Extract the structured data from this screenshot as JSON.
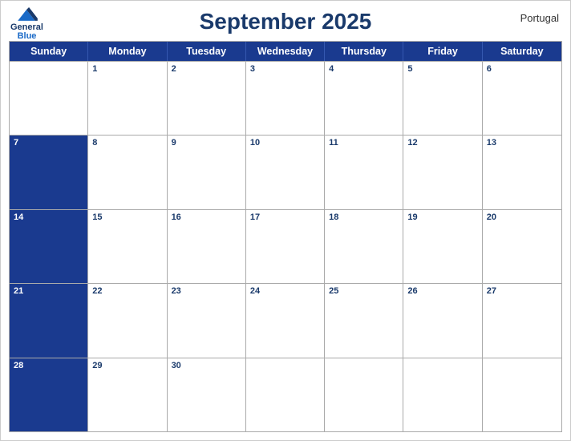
{
  "header": {
    "title": "September 2025",
    "country": "Portugal",
    "logo": {
      "line1": "General",
      "line2": "Blue"
    }
  },
  "days_of_week": [
    "Sunday",
    "Monday",
    "Tuesday",
    "Wednesday",
    "Thursday",
    "Friday",
    "Saturday"
  ],
  "weeks": [
    [
      {
        "num": "",
        "blue": false
      },
      {
        "num": "1",
        "blue": false
      },
      {
        "num": "2",
        "blue": false
      },
      {
        "num": "3",
        "blue": false
      },
      {
        "num": "4",
        "blue": false
      },
      {
        "num": "5",
        "blue": false
      },
      {
        "num": "6",
        "blue": false
      }
    ],
    [
      {
        "num": "7",
        "blue": true
      },
      {
        "num": "8",
        "blue": false
      },
      {
        "num": "9",
        "blue": false
      },
      {
        "num": "10",
        "blue": false
      },
      {
        "num": "11",
        "blue": false
      },
      {
        "num": "12",
        "blue": false
      },
      {
        "num": "13",
        "blue": false
      }
    ],
    [
      {
        "num": "14",
        "blue": true
      },
      {
        "num": "15",
        "blue": false
      },
      {
        "num": "16",
        "blue": false
      },
      {
        "num": "17",
        "blue": false
      },
      {
        "num": "18",
        "blue": false
      },
      {
        "num": "19",
        "blue": false
      },
      {
        "num": "20",
        "blue": false
      }
    ],
    [
      {
        "num": "21",
        "blue": true
      },
      {
        "num": "22",
        "blue": false
      },
      {
        "num": "23",
        "blue": false
      },
      {
        "num": "24",
        "blue": false
      },
      {
        "num": "25",
        "blue": false
      },
      {
        "num": "26",
        "blue": false
      },
      {
        "num": "27",
        "blue": false
      }
    ],
    [
      {
        "num": "28",
        "blue": true
      },
      {
        "num": "29",
        "blue": false
      },
      {
        "num": "30",
        "blue": false
      },
      {
        "num": "",
        "blue": false
      },
      {
        "num": "",
        "blue": false
      },
      {
        "num": "",
        "blue": false
      },
      {
        "num": "",
        "blue": false
      }
    ]
  ],
  "accent_color": "#1a3a8f"
}
